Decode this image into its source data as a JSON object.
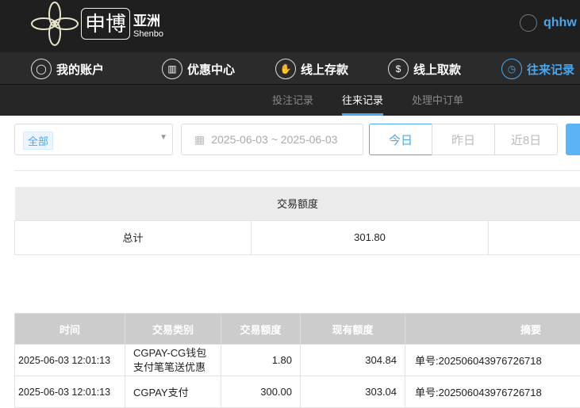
{
  "header": {
    "brand_cn": "申博",
    "brand_sub_cn": "亚洲",
    "brand_en": "Shenbo",
    "username": "qhhw"
  },
  "nav": [
    {
      "label": "我的账户",
      "icon": "user-icon"
    },
    {
      "label": "优惠中心",
      "icon": "gift-icon"
    },
    {
      "label": "线上存款",
      "icon": "deposit-icon"
    },
    {
      "label": "线上取款",
      "icon": "withdraw-icon"
    },
    {
      "label": "往来记录",
      "icon": "record-icon",
      "active": true
    }
  ],
  "subnav": [
    {
      "label": "投注记录"
    },
    {
      "label": "往来记录",
      "active": true
    },
    {
      "label": "处理中订单"
    }
  ],
  "filters": {
    "type_selected": "全部",
    "date_range": "2025-06-03 ~ 2025-06-03",
    "quick": [
      "今日",
      "昨日",
      "近8日"
    ],
    "quick_active": "今日"
  },
  "summary": {
    "header": "交易额度",
    "row_label": "总计",
    "amount": "301.80"
  },
  "table": {
    "columns": [
      "时间",
      "交易类别",
      "交易额度",
      "现有额度",
      "摘要"
    ],
    "rows": [
      [
        "2025-06-03 12:01:13",
        "CGPAY-CG钱包支付笔笔送优惠",
        "1.80",
        "304.84",
        "单号:202506043976726718"
      ],
      [
        "2025-06-03 12:01:13",
        "CGPAY支付",
        "300.00",
        "303.04",
        "单号:202506043976726718"
      ]
    ]
  },
  "colors": {
    "accent": "#4aa8f0",
    "header_bg": "#1f1f1f",
    "table_header": "#cccccc"
  }
}
